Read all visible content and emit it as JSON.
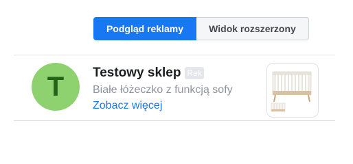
{
  "tabs": {
    "preview": "Podgląd reklamy",
    "expanded": "Widok rozszerzony"
  },
  "ad": {
    "avatar_letter": "T",
    "title": "Testowy sklep",
    "badge": "Rek",
    "description": "Białe łóżeczko z funkcją sofy",
    "cta": "Zobacz więcej",
    "thumbnail_icon": "crib-image"
  },
  "colors": {
    "accent": "#1877f2",
    "avatar_bg": "#8ed16f",
    "avatar_letter": "#24631a"
  }
}
